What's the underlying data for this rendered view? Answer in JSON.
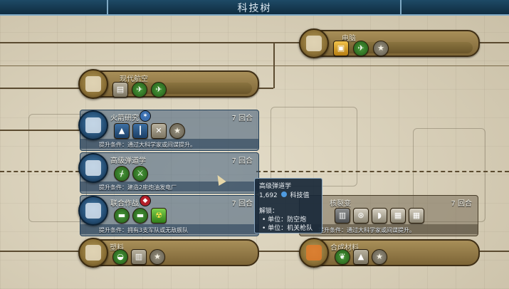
{
  "title": "科技树",
  "nodes": {
    "radio": {
      "name": "电脑"
    },
    "modern_flight": {
      "name": "现代航空"
    },
    "plastics": {
      "name": "塑料"
    },
    "synthetic": {
      "name": "合成材料"
    }
  },
  "panels": {
    "rocketry": {
      "name": "火箭研究",
      "turns": "7 回合",
      "cond": "提升条件：通过大科学家或间谍提升。"
    },
    "ballistics": {
      "name": "高级弹道学",
      "turns": "7 回合",
      "cond": "提升条件：建造2座炮油发电厂"
    },
    "combined_arms": {
      "name": "联合作战",
      "turns": "7 回合",
      "cond": "提升条件：拥有3支军队或无敌舰队"
    },
    "nuclear_fission": {
      "name": "核裂变",
      "turns": "7 回合",
      "cond": "提升条件：通过大科学家或间谍提升。"
    }
  },
  "tooltip": {
    "title": "高级弹道学",
    "cost_value": "1,692",
    "cost_label": "科技值",
    "unlocks_label": "解锁：",
    "unlock_1": "• 单位：防空炮",
    "unlock_2": "• 单位：机关枪队"
  },
  "icons": {
    "star": "★",
    "plane": "✈",
    "nuke": "☢"
  }
}
